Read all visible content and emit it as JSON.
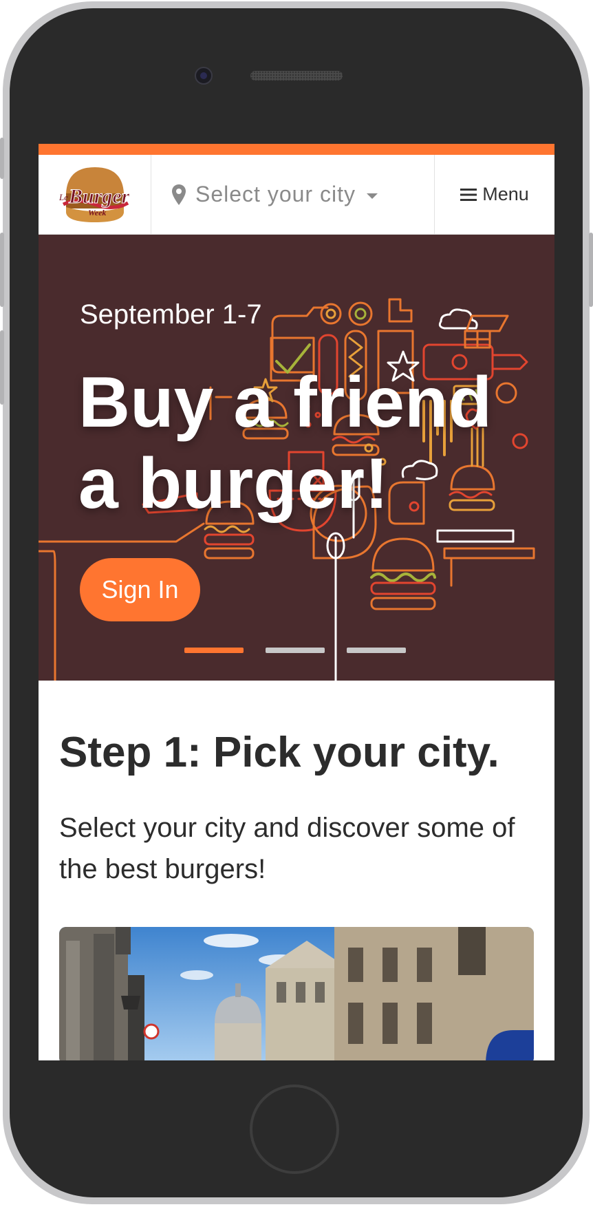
{
  "colors": {
    "accent": "#ff7530",
    "hero_bg": "#4a2b2d",
    "text_dark": "#2c2c2c",
    "muted": "#8a8a8a"
  },
  "header": {
    "logo": {
      "le": "Le",
      "burger": "Burger",
      "week": "Week"
    },
    "city_select": {
      "label": "Select your city",
      "icon": "map-pin-icon"
    },
    "menu": {
      "label": "Menu",
      "icon": "hamburger-icon"
    }
  },
  "hero": {
    "date": "September 1-7",
    "headline_line1": "Buy a friend",
    "headline_line2": "a burger!",
    "cta": "Sign In",
    "slides": {
      "count": 3,
      "active": 1
    }
  },
  "main": {
    "step_title": "Step 1: Pick your city.",
    "step_text": "Select your city and discover some of the best burgers!"
  }
}
